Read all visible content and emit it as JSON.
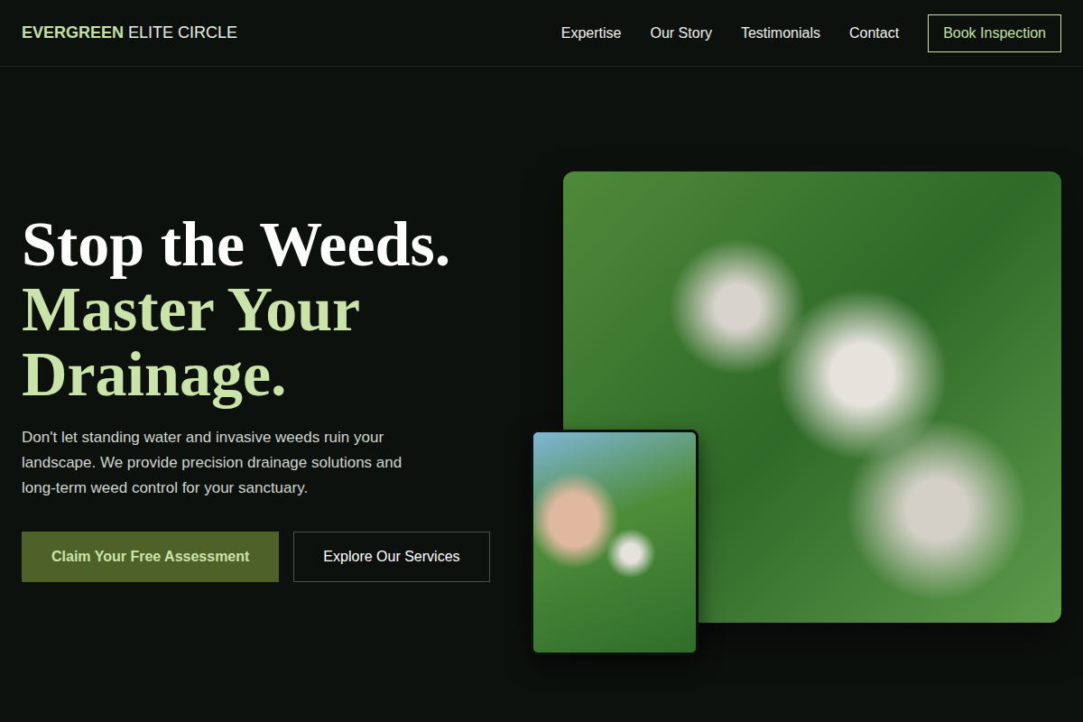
{
  "header": {
    "brand": {
      "strong": "EVERGREEN",
      "rest": "ELITE CIRCLE"
    },
    "nav": [
      "Expertise",
      "Our Story",
      "Testimonials",
      "Contact"
    ],
    "cta": "Book Inspection"
  },
  "hero": {
    "title_lines": [
      {
        "text": "Stop the Weeds.",
        "highlight": false
      },
      {
        "text": "Master Your Drainage.",
        "highlight": true
      }
    ],
    "description": "Don't let standing water and invasive weeds ruin your landscape. We provide precision drainage solutions and long-term weed control for your sanctuary.",
    "buttons": [
      {
        "label": "Claim Your Free Assessment",
        "kind": "primary"
      },
      {
        "label": "Explore Our Services",
        "kind": "outline"
      }
    ]
  }
}
